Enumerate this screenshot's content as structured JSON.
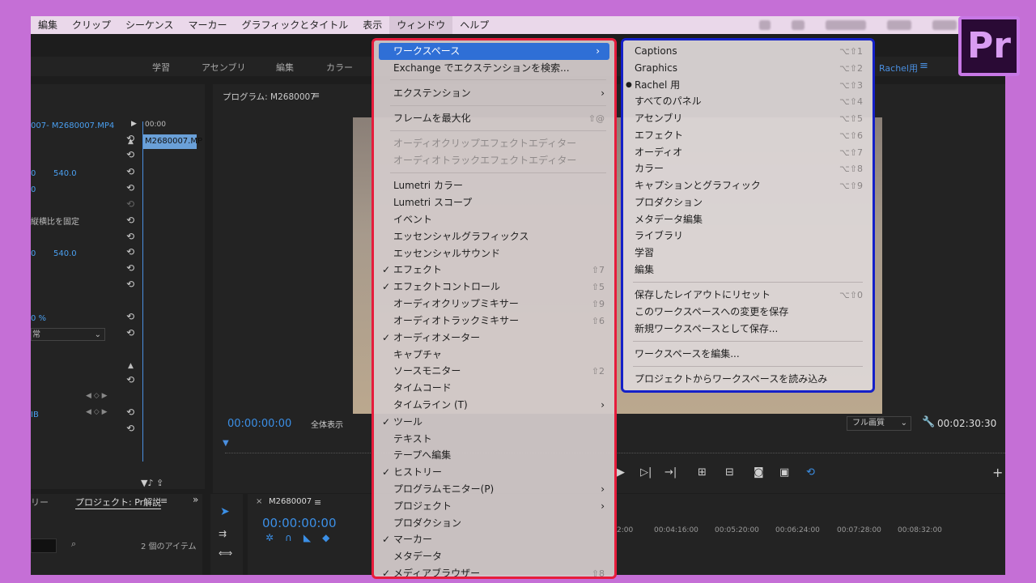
{
  "menubar": {
    "items": [
      "編集",
      "クリップ",
      "シーケンス",
      "マーカー",
      "グラフィックとタイトル",
      "表示",
      "ウィンドウ",
      "ヘルプ"
    ],
    "active": "ウィンドウ"
  },
  "workspaces": {
    "tabs": [
      "学習",
      "アセンブリ",
      "編集",
      "カラー"
    ],
    "current": "Rachel用",
    "menu_icon": "≡"
  },
  "effect_controls": {
    "clip_path": "007- M2680007.MP4",
    "ruler_time": "00:00",
    "clip_name": "M2680007.MP",
    "rows": [
      {
        "a": "0",
        "b": "540.0"
      },
      {
        "a": "0",
        "b": ""
      },
      {
        "a": "縦横比を固定",
        "b": ""
      },
      {
        "a": "0",
        "b": "540.0"
      },
      {
        "a": "0 %",
        "b": ""
      },
      {
        "a": "常",
        "b": ""
      },
      {
        "a": "IB",
        "b": ""
      }
    ]
  },
  "program_monitor": {
    "title": "プログラム: M2680007",
    "timecode_left": "00:00:00:00",
    "fit_label": "全体表示",
    "quality_label": "フル画質",
    "timecode_right": "00:02:30:30"
  },
  "project_panel": {
    "tab_partial": "リー",
    "tab": "プロジェクト: Pr解説",
    "items_count": "2 個のアイテム"
  },
  "timeline": {
    "sequence": "M2680007",
    "timecode": "00:00:00:00",
    "ruler": [
      "2:00",
      "00:04:16:00",
      "00:05:20:00",
      "00:06:24:00",
      "00:07:28:00",
      "00:08:32:00"
    ]
  },
  "window_menu": {
    "items": [
      {
        "label": "ワークスペース",
        "arrow": true,
        "highlight": true
      },
      {
        "label": "Exchange でエクステンションを検索..."
      },
      {
        "sep": true
      },
      {
        "label": "エクステンション",
        "arrow": true
      },
      {
        "sep": true
      },
      {
        "label": "フレームを最大化",
        "shortcut": "⇧@"
      },
      {
        "sep": true
      },
      {
        "label": "オーディオクリップエフェクトエディター",
        "disabled": true
      },
      {
        "label": "オーディオトラックエフェクトエディター",
        "disabled": true
      },
      {
        "sep": true
      },
      {
        "label": "Lumetri カラー"
      },
      {
        "label": "Lumetri スコープ"
      },
      {
        "label": "イベント"
      },
      {
        "label": "エッセンシャルグラフィックス"
      },
      {
        "label": "エッセンシャルサウンド"
      },
      {
        "label": "エフェクト",
        "check": true,
        "shortcut": "⇧7"
      },
      {
        "label": "エフェクトコントロール",
        "check": true,
        "shortcut": "⇧5"
      },
      {
        "label": "オーディオクリップミキサー",
        "shortcut": "⇧9"
      },
      {
        "label": "オーディオトラックミキサー",
        "shortcut": "⇧6"
      },
      {
        "label": "オーディオメーター",
        "check": true
      },
      {
        "label": "キャプチャ"
      },
      {
        "label": "ソースモニター",
        "shortcut": "⇧2"
      },
      {
        "label": "タイムコード"
      },
      {
        "label": "タイムライン (T)",
        "arrow": true
      },
      {
        "label": "ツール",
        "check": true
      },
      {
        "label": "テキスト"
      },
      {
        "label": "テープへ編集"
      },
      {
        "label": "ヒストリー",
        "check": true
      },
      {
        "label": "プログラムモニター(P)",
        "arrow": true
      },
      {
        "label": "プロジェクト",
        "arrow": true
      },
      {
        "label": "プロダクション"
      },
      {
        "label": "マーカー",
        "check": true
      },
      {
        "label": "メタデータ"
      },
      {
        "label": "メディアブラウザー",
        "check": true,
        "shortcut": "⇧8"
      }
    ]
  },
  "workspace_submenu": {
    "items": [
      {
        "label": "Captions",
        "shortcut": "⌥⇧1"
      },
      {
        "label": "Graphics",
        "shortcut": "⌥⇧2"
      },
      {
        "label": "Rachel 用",
        "shortcut": "⌥⇧3",
        "bullet": true
      },
      {
        "label": "すべてのパネル",
        "shortcut": "⌥⇧4"
      },
      {
        "label": "アセンブリ",
        "shortcut": "⌥⇧5"
      },
      {
        "label": "エフェクト",
        "shortcut": "⌥⇧6"
      },
      {
        "label": "オーディオ",
        "shortcut": "⌥⇧7"
      },
      {
        "label": "カラー",
        "shortcut": "⌥⇧8"
      },
      {
        "label": "キャプションとグラフィック",
        "shortcut": "⌥⇧9"
      },
      {
        "label": "プロダクション"
      },
      {
        "label": "メタデータ編集"
      },
      {
        "label": "ライブラリ"
      },
      {
        "label": "学習"
      },
      {
        "label": "編集"
      },
      {
        "sep": true
      },
      {
        "label": "保存したレイアウトにリセット",
        "shortcut": "⌥⇧0"
      },
      {
        "label": "このワークスペースへの変更を保存"
      },
      {
        "label": "新規ワークスペースとして保存..."
      },
      {
        "sep": true
      },
      {
        "label": "ワークスペースを編集..."
      },
      {
        "sep": true
      },
      {
        "label": "プロジェクトからワークスペースを読み込み"
      }
    ]
  },
  "logo": {
    "text": "Pr",
    "color": "#c878e6"
  },
  "colors": {
    "accent": "#3b8fe6",
    "frame": "#c56fd6",
    "menu_border": "#e61c3c",
    "submenu_border": "#1420c8"
  }
}
